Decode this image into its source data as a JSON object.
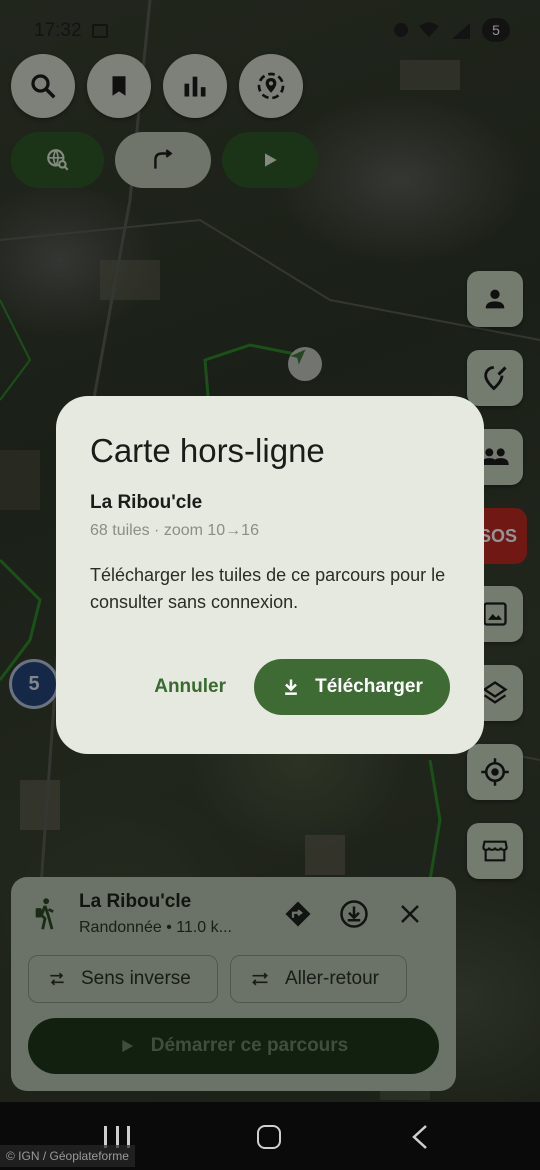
{
  "status_bar": {
    "time": "17:32",
    "badge": "5"
  },
  "top_buttons": [
    "search-icon",
    "bookmark-icon",
    "bar-chart-icon",
    "location-target-icon"
  ],
  "pill_buttons": [
    "globe-search-icon",
    "route-icon",
    "play-icon"
  ],
  "side_buttons": [
    "person-icon",
    "edit-location-icon",
    "group-icon",
    "sos",
    "image-icon",
    "layers-icon",
    "gps-crosshair-icon",
    "storefront-icon"
  ],
  "sos_label": "SOS",
  "map_marker_label": "5",
  "dialog": {
    "title": "Carte hors-ligne",
    "route_name": "La Ribou'cle",
    "meta": "68 tuiles · zoom 10→16",
    "body": "Télécharger les tuiles de ce parcours pour le consulter sans connexion.",
    "cancel_label": "Annuler",
    "download_label": "Télécharger"
  },
  "route_card": {
    "name": "La Ribou'cle",
    "subtitle": "Randonnée • 11.0 k...",
    "reverse_label": "Sens inverse",
    "roundtrip_label": "Aller-retour",
    "start_label": "Démarrer ce parcours"
  },
  "attribution": "© IGN / Géoplateforme",
  "colors": {
    "primary": "#3d6b33",
    "dialog_bg": "#e5e9e0",
    "sos": "#c12a24",
    "side_button": "#c6d6c0"
  }
}
